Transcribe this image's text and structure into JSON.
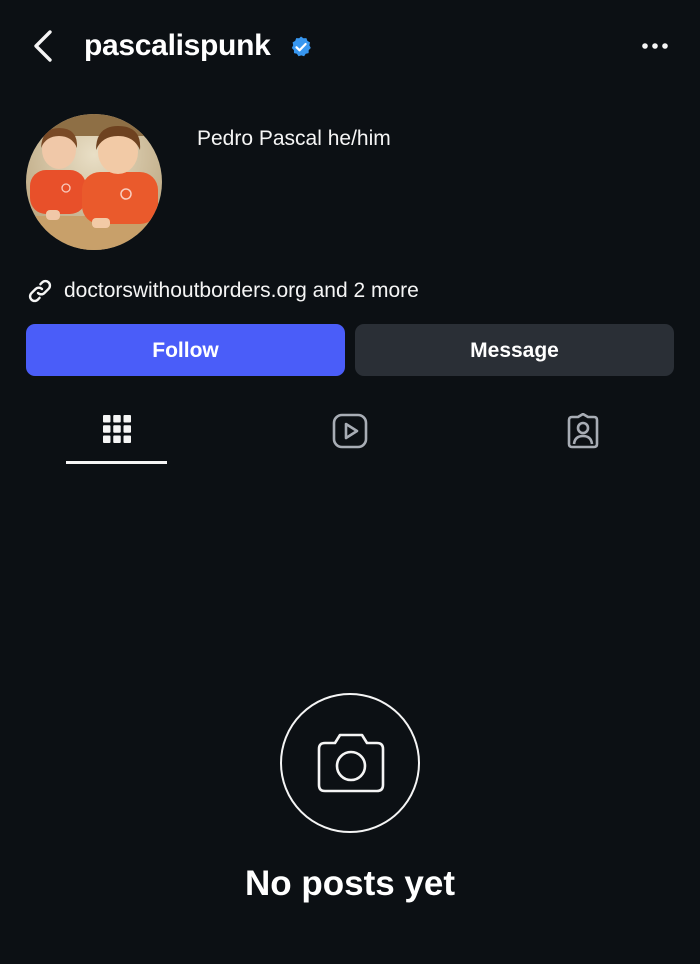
{
  "header": {
    "back_icon": "chevron-left-icon",
    "username": "pascalispunk",
    "verified_icon": "verified-badge-icon",
    "more_icon": "more-horizontal-icon"
  },
  "profile": {
    "avatar_description": "profile-photo",
    "display_name": "Pedro Pascal he/him",
    "link_icon": "link-icon",
    "link_text": "doctorswithoutborders.org and 2 more"
  },
  "actions": {
    "follow_label": "Follow",
    "message_label": "Message"
  },
  "tabs": [
    {
      "name": "posts",
      "icon": "grid-icon",
      "active": true
    },
    {
      "name": "reels",
      "icon": "reels-icon",
      "active": false
    },
    {
      "name": "tagged",
      "icon": "tagged-icon",
      "active": false
    }
  ],
  "empty_state": {
    "icon": "camera-icon",
    "text": "No posts yet"
  },
  "colors": {
    "background": "#0c1014",
    "follow_button": "#4a5df9",
    "message_button": "#2a2f36",
    "verified_badge": "#3897f0"
  }
}
